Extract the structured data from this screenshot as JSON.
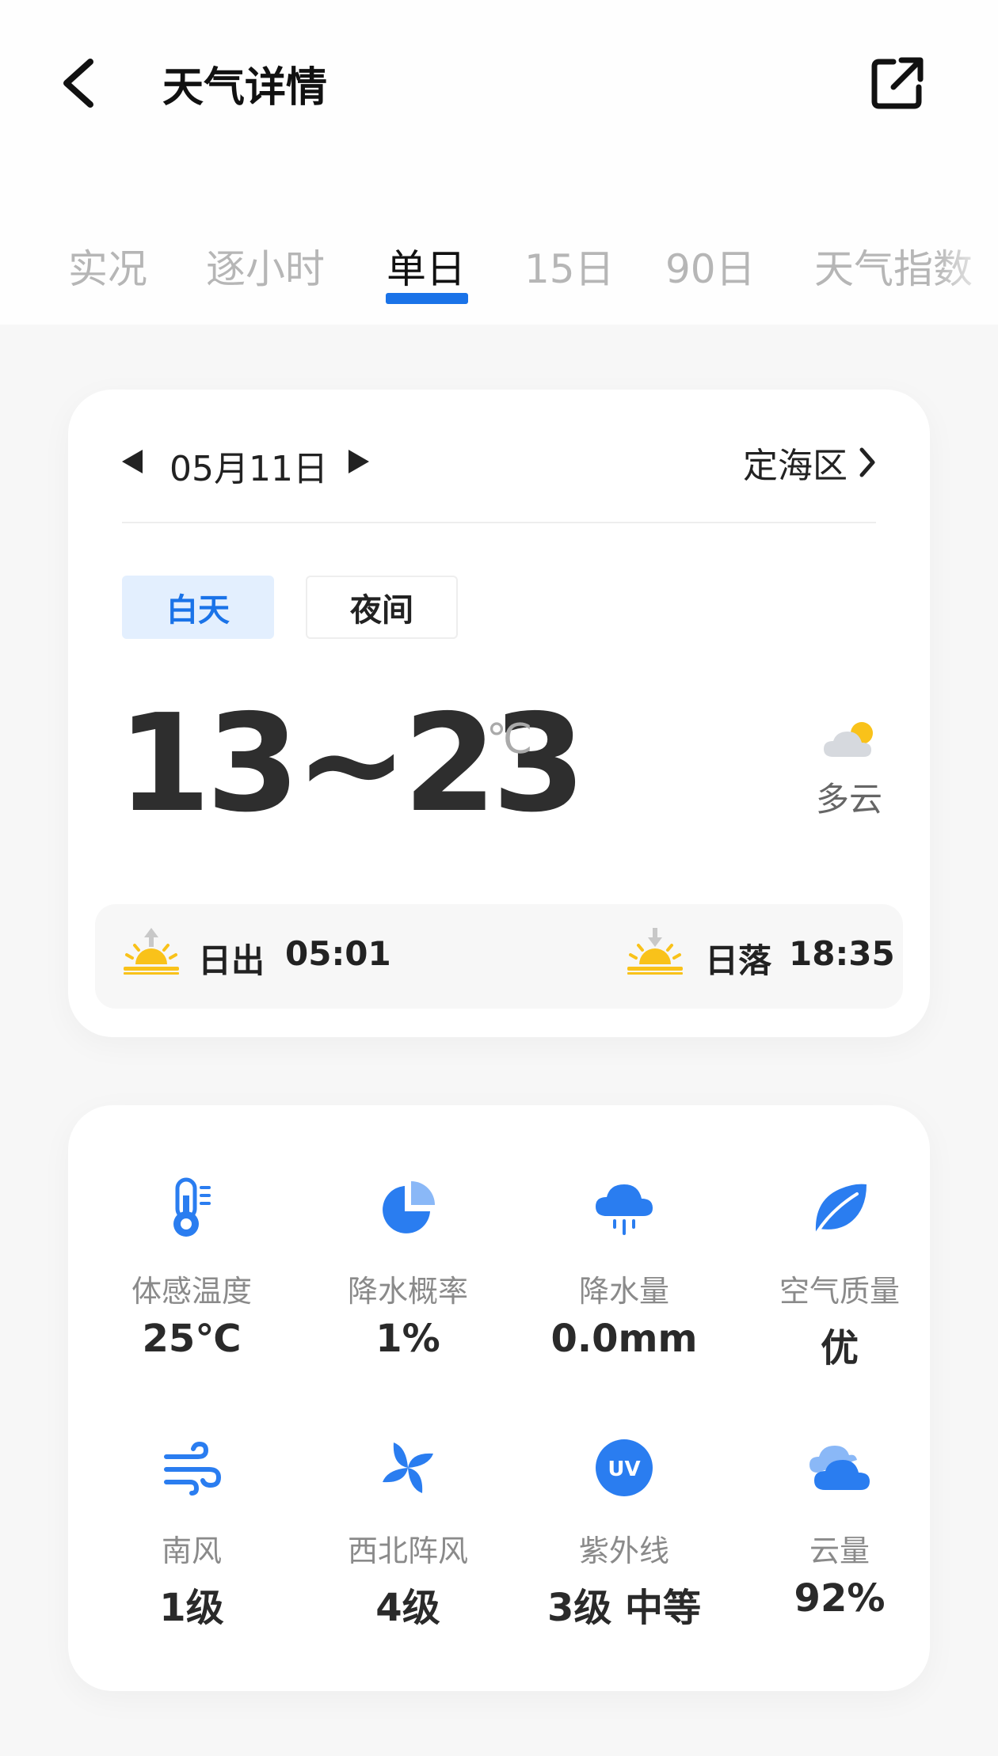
{
  "header": {
    "title": "天气详情"
  },
  "tabs": [
    {
      "label": "实况"
    },
    {
      "label": "逐小时"
    },
    {
      "label": "单日",
      "active": true
    },
    {
      "label": "15日"
    },
    {
      "label": "90日"
    },
    {
      "label": "天气指数"
    }
  ],
  "day_card": {
    "date": "05月11日",
    "location": "定海区",
    "segments": {
      "day": "白天",
      "night": "夜间",
      "selected": "白天"
    },
    "temperature": "13~23",
    "unit": "℃",
    "condition": "多云",
    "sunrise": {
      "label": "日出",
      "time": "05:01"
    },
    "sunset": {
      "label": "日落",
      "time": "18:35"
    }
  },
  "metrics": [
    {
      "label": "体感温度",
      "value": "25℃",
      "icon": "thermometer-icon"
    },
    {
      "label": "降水概率",
      "value": "1%",
      "icon": "pie-chart-icon"
    },
    {
      "label": "降水量",
      "value": "0.0mm",
      "icon": "rain-cloud-icon"
    },
    {
      "label": "空气质量",
      "value": "优",
      "icon": "leaf-icon"
    },
    {
      "label": "南风",
      "value": "1级",
      "icon": "wind-icon"
    },
    {
      "label": "西北阵风",
      "value": "4级",
      "icon": "pinwheel-icon"
    },
    {
      "label": "紫外线",
      "value": "3级 中等",
      "icon": "uv-icon",
      "icon_text": "UV"
    },
    {
      "label": "云量",
      "value": "92%",
      "icon": "cloud-icon"
    }
  ],
  "colors": {
    "accent": "#1a73e8",
    "sun": "#f9c21a",
    "icon_blue": "#2a7df0"
  }
}
